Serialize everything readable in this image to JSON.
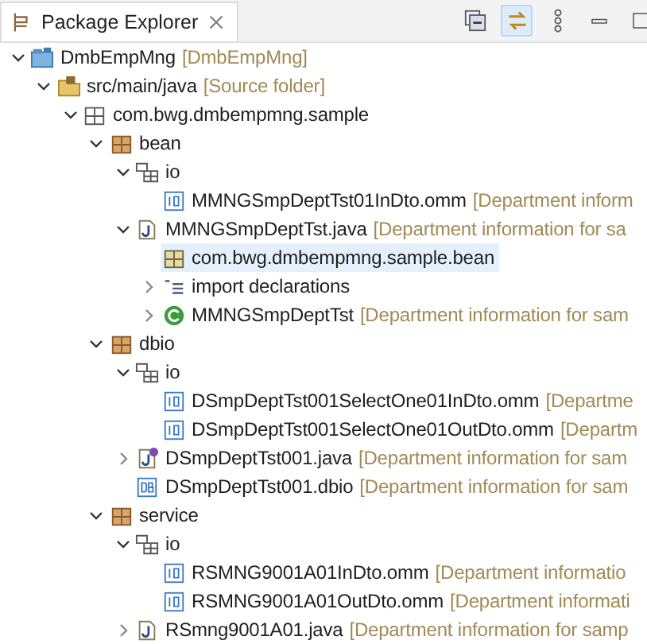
{
  "view": {
    "tab": {
      "title": "Package Explorer",
      "selected": true
    },
    "toolbar": [
      {
        "kind": "collapse-all",
        "selected": false
      },
      {
        "kind": "link-editor",
        "selected": true
      },
      {
        "kind": "view-menu",
        "selected": false
      },
      {
        "kind": "minimize",
        "selected": false
      },
      {
        "kind": "maximize",
        "selected": false
      }
    ]
  },
  "tree": [
    {
      "kind": "project",
      "label": "DmbEmpMng",
      "decoration": "[DmbEmpMng]",
      "expanded": true,
      "selected": false,
      "children": [
        {
          "kind": "source-folder",
          "label": "src/main/java",
          "decoration": "[Source folder]",
          "expanded": true,
          "selected": false,
          "children": [
            {
              "kind": "package",
              "label": "com.bwg.dmbempmng.sample",
              "expanded": true,
              "selected": false,
              "children": [
                {
                  "kind": "brown-package",
                  "label": "bean",
                  "expanded": true,
                  "selected": false,
                  "children": [
                    {
                      "kind": "io-folder",
                      "label": "io",
                      "expanded": true,
                      "selected": false,
                      "children": [
                        {
                          "kind": "io-file",
                          "label": "MMNGSmpDeptTst01InDto.omm",
                          "decoration": "[Department inform",
                          "selected": false
                        }
                      ]
                    },
                    {
                      "kind": "java-file",
                      "label": "MMNGSmpDeptTst.java",
                      "decoration": "[Department information for sa",
                      "expanded": true,
                      "selected": false,
                      "children": [
                        {
                          "kind": "package-declaration",
                          "label": "com.bwg.dmbempmng.sample.bean",
                          "selected": true
                        },
                        {
                          "kind": "imports",
                          "label": "import declarations",
                          "expanded": false,
                          "selected": false
                        },
                        {
                          "kind": "class",
                          "label": "MMNGSmpDeptTst",
                          "decoration": "[Department information for sam",
                          "expanded": false,
                          "selected": false
                        }
                      ]
                    }
                  ]
                },
                {
                  "kind": "brown-package",
                  "label": "dbio",
                  "expanded": true,
                  "selected": false,
                  "children": [
                    {
                      "kind": "io-folder",
                      "label": "io",
                      "expanded": true,
                      "selected": false,
                      "children": [
                        {
                          "kind": "io-file",
                          "label": "DSmpDeptTst001SelectOne01InDto.omm",
                          "decoration": "[Departme",
                          "selected": false
                        },
                        {
                          "kind": "io-file",
                          "label": "DSmpDeptTst001SelectOne01OutDto.omm",
                          "decoration": "[Departm",
                          "selected": false
                        }
                      ]
                    },
                    {
                      "kind": "java-interface-file",
                      "label": "DSmpDeptTst001.java",
                      "decoration": "[Department information for sam",
                      "expanded": false,
                      "selected": false
                    },
                    {
                      "kind": "db-file",
                      "label": "DSmpDeptTst001.dbio",
                      "decoration": "[Department information for sam",
                      "selected": false
                    }
                  ]
                },
                {
                  "kind": "brown-package",
                  "label": "service",
                  "expanded": true,
                  "selected": false,
                  "children": [
                    {
                      "kind": "io-folder",
                      "label": "io",
                      "expanded": true,
                      "selected": false,
                      "children": [
                        {
                          "kind": "io-file",
                          "label": "RSMNG9001A01InDto.omm",
                          "decoration": "[Department informatio",
                          "selected": false
                        },
                        {
                          "kind": "io-file",
                          "label": "RSMNG9001A01OutDto.omm",
                          "decoration": "[Department informati",
                          "selected": false
                        }
                      ]
                    },
                    {
                      "kind": "java-file",
                      "label": "RSmng9001A01.java",
                      "decoration": "[Department information for samp",
                      "expanded": false,
                      "selected": false
                    }
                  ]
                }
              ]
            }
          ]
        }
      ]
    }
  ]
}
